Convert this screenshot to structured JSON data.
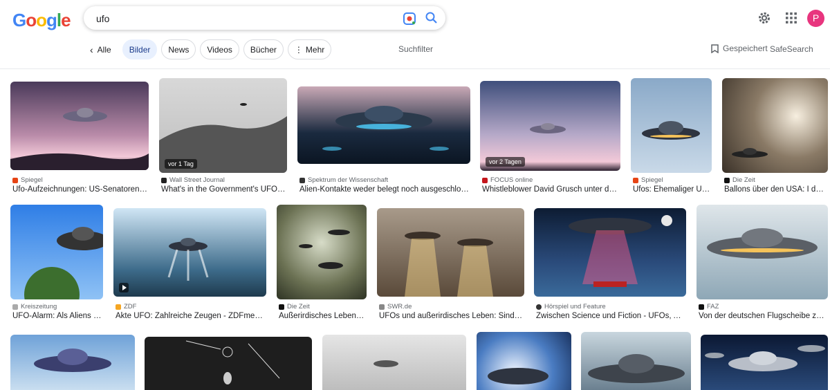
{
  "header": {
    "logo": "Google",
    "search_value": "ufo",
    "avatar_letter": "P"
  },
  "tabs": {
    "back_label": "Alle",
    "chips": [
      "Bilder",
      "News",
      "Videos",
      "Bücher",
      "Mehr"
    ],
    "filter": "Suchfilter",
    "saved": "Gespeichert",
    "safesearch": "SafeSearch"
  },
  "results": [
    {
      "source": "Spiegel",
      "title": "Ufo-Aufzeichnungen: US-Senatoren wollen …",
      "badge": ""
    },
    {
      "source": "Wall Street Journal",
      "title": "What's in the Government's UFO Files? …",
      "badge": "vor 1 Tag"
    },
    {
      "source": "Spektrum der Wissenschaft",
      "title": "Alien-Kontakte weder belegt noch ausgeschlossen …",
      "badge": ""
    },
    {
      "source": "FOCUS online",
      "title": "Whistleblower David Grusch unter den …",
      "badge": "vor 2 Tagen"
    },
    {
      "source": "Spiegel",
      "title": "Ufos: Ehemaliger US-…",
      "badge": ""
    },
    {
      "source": "Die Zeit",
      "title": "Ballons über den USA: I don't …",
      "badge": ""
    },
    {
      "source": "Kreiszeitung",
      "title": "UFO-Alarm: Als Aliens v…",
      "badge": ""
    },
    {
      "source": "ZDF",
      "title": "Akte UFO: Zahlreiche Zeugen - ZDFmediathek",
      "badge": ""
    },
    {
      "source": "Die Zeit",
      "title": "Außerirdisches Leben: …",
      "badge": ""
    },
    {
      "source": "SWR.de",
      "title": "UFOs und außerirdisches Leben: Sind wir …",
      "badge": ""
    },
    {
      "source": "Hörspiel und Feature",
      "title": "Zwischen Science und Fiction - UFOs, Aliens …",
      "badge": ""
    },
    {
      "source": "FAZ",
      "title": "Von der deutschen Flugscheibe zum …",
      "badge": ""
    }
  ],
  "colors": {
    "accent": "#1a73e8",
    "chip_active_bg": "#e8f0fe",
    "avatar": "#e8357e"
  }
}
